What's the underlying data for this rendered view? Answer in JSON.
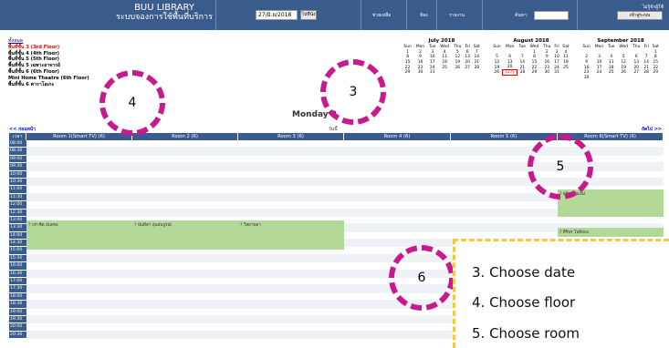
{
  "header": {
    "title_en": "BUU LIBRARY",
    "title_th": "ระบบจองการใช้พื้นที่บริการ",
    "date_value": "27/มิ.ย/2018",
    "go_label": "ไปที่นั่ง",
    "help": "ช่วยเหลือ",
    "rooms": "ห้อง",
    "report": "รายงาน",
    "search_label": "ค้นหา:",
    "user_status": "ไม่รู้จักผู้ใช้",
    "login": "เข้าสู่ระบบ"
  },
  "floors": {
    "all": "ทั้งหมด",
    "items": [
      "พื้นที่ชั้น 3 (3rd Floor)",
      "พื้นที่ชั้น 4 (4th Floor)",
      "พื้นที่ชั้น 5 (5th Floor)",
      "พื้นที่ชั้น 5 เฉพาะอาจารย์",
      "พื้นที่ชั้น 6 (6th Floor)",
      "Mini Home Theatre (6th Floor)",
      "พื้นที่ชั้น 6 คาราโอเกะ"
    ]
  },
  "calendars": [
    {
      "title": "July 2018",
      "days": [
        "Sun",
        "Mon",
        "Tue",
        "Wed",
        "Thu",
        "Fri",
        "Sat"
      ],
      "weeks": [
        [
          "1",
          "2",
          "3",
          "4",
          "5",
          "6",
          "7"
        ],
        [
          "8",
          "9",
          "10",
          "11",
          "12",
          "13",
          "14"
        ],
        [
          "15",
          "16",
          "17",
          "18",
          "19",
          "20",
          "21"
        ],
        [
          "22",
          "23",
          "24",
          "25",
          "26",
          "27",
          "28"
        ],
        [
          "29",
          "30",
          "31",
          "",
          "",
          "",
          ""
        ]
      ]
    },
    {
      "title": "August 2018",
      "days": [
        "Sun",
        "Mon",
        "Tue",
        "Wed",
        "Thu",
        "Fri",
        "Sat"
      ],
      "weeks": [
        [
          "",
          "",
          "",
          "1",
          "2",
          "3",
          "4"
        ],
        [
          "5",
          "6",
          "7",
          "8",
          "9",
          "10",
          "11"
        ],
        [
          "12",
          "13",
          "14",
          "15",
          "16",
          "17",
          "18"
        ],
        [
          "19",
          "20",
          "21",
          "22",
          "23",
          "24",
          "25"
        ],
        [
          "26",
          "[27]",
          "28",
          "29",
          "30",
          "31",
          ""
        ]
      ]
    },
    {
      "title": "September 2018",
      "days": [
        "Sun",
        "Mon",
        "Tue",
        "Wed",
        "Thu",
        "Fri",
        "Sat"
      ],
      "weeks": [
        [
          "",
          "",
          "",
          "",
          "",
          "",
          "1"
        ],
        [
          "2",
          "3",
          "4",
          "5",
          "6",
          "7",
          "8"
        ],
        [
          "9",
          "10",
          "11",
          "12",
          "13",
          "14",
          "15"
        ],
        [
          "16",
          "17",
          "18",
          "19",
          "20",
          "21",
          "22"
        ],
        [
          "23",
          "24",
          "25",
          "26",
          "27",
          "28",
          "29"
        ],
        [
          "30",
          "",
          "",
          "",
          "",
          "",
          ""
        ]
      ]
    }
  ],
  "day_title": "Monday 2",
  "prev": "<< ก่อนหน้า",
  "next": "ถัดไป >>",
  "today": "วันนี้",
  "grid": {
    "time_header": "เวลา",
    "rooms": [
      "Room 1(Smart TV) (6)",
      "Room 2 (6)",
      "Room 3 (6)",
      "Room 4 (6)",
      "Room 5 (6)",
      "Room 6(Smart TV) (6)"
    ],
    "times": [
      "08:00",
      "08:30",
      "09:00",
      "09:30",
      "10:00",
      "10:30",
      "11:00",
      "11:30",
      "12:00",
      "12:30",
      "13:00",
      "13:30",
      "14:00",
      "14:30",
      "15:00",
      "15:30",
      "16:00",
      "16:30",
      "17:00",
      "17:30",
      "18:00",
      "18:30",
      "19:00",
      "19:30",
      "20:00",
      "20:30"
    ]
  },
  "bookings": [
    "? ปราชิต มัณฑล",
    "? นันทิตา อุ่นสมบูรณ์",
    "? วิทยาพลา",
    "? สุจิรา ทีมเพ็ง",
    "? ศิริพร โพธิทอง"
  ],
  "badges": [
    "3",
    "4",
    "5",
    "6"
  ],
  "legend": [
    "3. Choose date",
    "4. Choose floor",
    "5. Choose room"
  ],
  "colors": {
    "header": "#3a5c8c",
    "booking": "#b3d998",
    "badge": "#c71a8e",
    "legend_border": "#f5c842"
  }
}
